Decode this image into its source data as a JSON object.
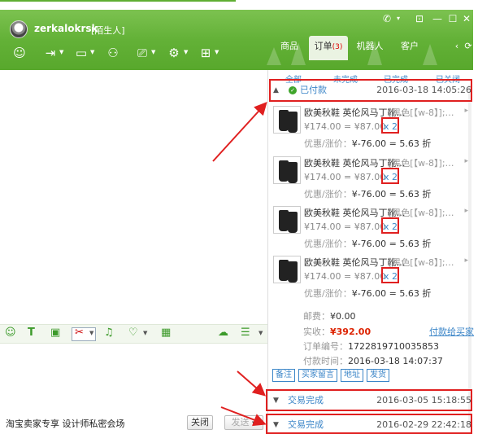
{
  "contact": {
    "name": "zerkalokrsk",
    "tag": "[陌生人]"
  },
  "toolbar_icons": [
    "chat-icon",
    "transfer-icon",
    "video-icon",
    "add-contact-icon",
    "screen-share-icon",
    "remote-assist-icon",
    "more-apps-icon"
  ],
  "tabs": [
    {
      "label": "商品"
    },
    {
      "label": "订单",
      "badge": "(3)"
    },
    {
      "label": "机器人"
    },
    {
      "label": "客户"
    }
  ],
  "order_filters": [
    "全部",
    "未完成",
    "已完成",
    "已关闭"
  ],
  "orders": [
    {
      "status": "已付款",
      "time": "2016-03-18 14:05:26",
      "items": [
        {
          "name": "欧美秋鞋 英伦风马丁靴…",
          "spec": "[黑色[【w-8】];…",
          "price": "¥174.00 = ¥87.00",
          "qty": "x 2",
          "discount_label": "优惠/涨价：",
          "discount_value": "¥-76.00 = 5.63 折"
        },
        {
          "name": "欧美秋鞋 英伦风马丁靴…",
          "spec": "[黑色[【w-8】];…",
          "price": "¥174.00 = ¥87.00",
          "qty": "x 2",
          "discount_label": "优惠/涨价：",
          "discount_value": "¥-76.00 = 5.63 折"
        },
        {
          "name": "欧美秋鞋 英伦风马丁靴…",
          "spec": "[黑色[【w-8】];…",
          "price": "¥174.00 = ¥87.00",
          "qty": "x 2",
          "discount_label": "优惠/涨价：",
          "discount_value": "¥-76.00 = 5.63 折"
        },
        {
          "name": "欧美秋鞋 英伦风马丁靴…",
          "spec": "[黑色[【w-8】];…",
          "price": "¥174.00 = ¥87.00",
          "qty": "x 2",
          "discount_label": "优惠/涨价：",
          "discount_value": "¥-76.00 = 5.63 折"
        }
      ],
      "postage_label": "邮费：",
      "postage": "¥0.00",
      "paid_label": "实收：",
      "paid": "¥392.00",
      "order_no_label": "订单编号：",
      "order_no": "1722819710035853",
      "pay_time_label": "付款时间：",
      "pay_time": "2016-03-18 14:07:37",
      "link": "付款给买家",
      "actions": [
        "备注",
        "买家留言",
        "地址",
        "发货"
      ]
    },
    {
      "status": "交易完成",
      "time": "2016-03-05 15:18:55"
    },
    {
      "status": "交易完成",
      "time": "2016-02-29 22:42:18"
    }
  ],
  "promo_text": "淘宝卖家专享 设计师私密会场",
  "buttons": {
    "close": "关闭",
    "send": "发送"
  },
  "colors": {
    "header_green": "#63b137",
    "link_blue": "#3c86c8",
    "price_red": "#d20000",
    "annotation_red": "#e02020"
  }
}
